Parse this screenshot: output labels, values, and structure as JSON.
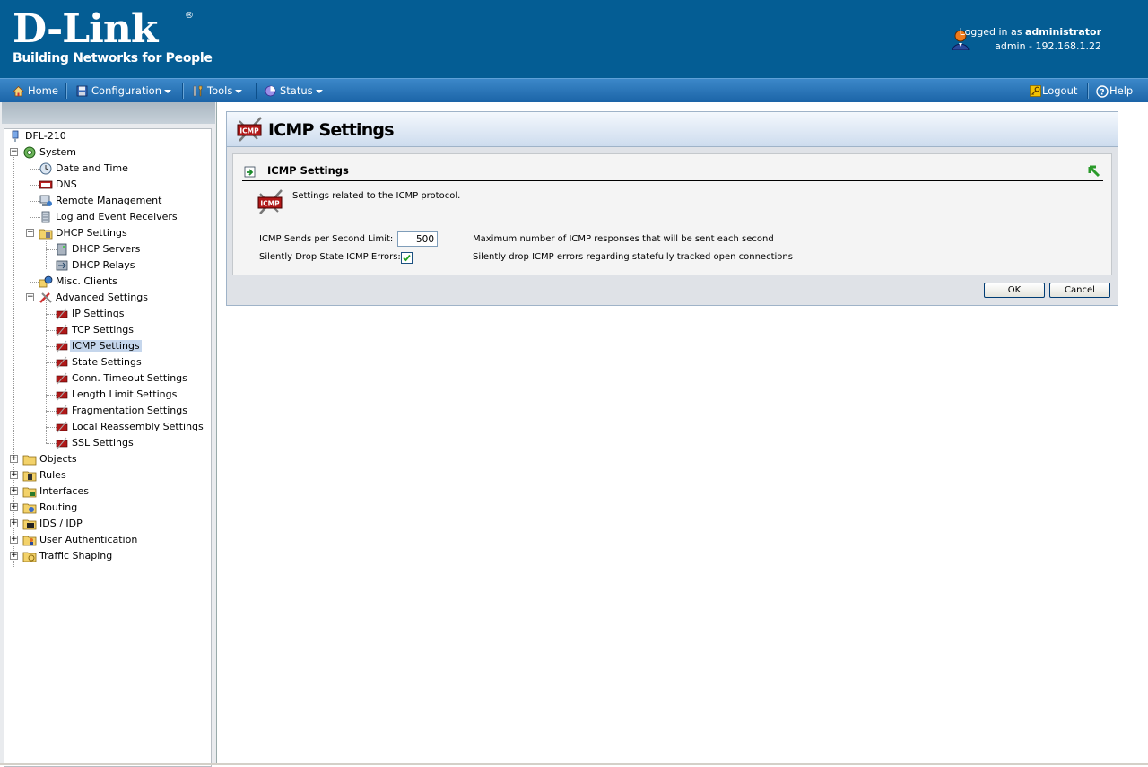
{
  "header": {
    "brand": "D-Link",
    "registered": "®",
    "tagline": "Building Networks for People",
    "logged_in_prefix": "Logged in as ",
    "user": "administrator",
    "session": "admin - 192.168.1.22"
  },
  "menu": {
    "home": "Home",
    "configuration": "Configuration",
    "tools": "Tools",
    "status": "Status",
    "logout": "Logout",
    "help": "Help"
  },
  "tree": {
    "root": "DFL-210",
    "system": "System",
    "date_time": "Date and Time",
    "dns": "DNS",
    "remote_mgmt": "Remote Management",
    "log_receivers": "Log and Event Receivers",
    "dhcp_settings": "DHCP Settings",
    "dhcp_servers": "DHCP Servers",
    "dhcp_relays": "DHCP Relays",
    "misc_clients": "Misc. Clients",
    "advanced": "Advanced Settings",
    "ip": "IP Settings",
    "tcp": "TCP Settings",
    "icmp": "ICMP Settings",
    "state": "State Settings",
    "conn_timeout": "Conn. Timeout Settings",
    "length_limit": "Length Limit Settings",
    "fragmentation": "Fragmentation Settings",
    "local_reassembly": "Local Reassembly Settings",
    "ssl": "SSL Settings",
    "objects": "Objects",
    "rules": "Rules",
    "interfaces": "Interfaces",
    "routing": "Routing",
    "ids_idp": "IDS / IDP",
    "user_auth": "User Authentication",
    "traffic_shaping": "Traffic Shaping"
  },
  "page": {
    "title": "ICMP Settings",
    "icon_text": "ICMP",
    "section_title": "ICMP Settings",
    "description": "Settings related to the ICMP protocol.",
    "fields": {
      "limit_label": "ICMP Sends per Second Limit:",
      "limit_value": "500",
      "limit_help": "Maximum number of ICMP responses that will be sent each second",
      "drop_label": "Silently Drop State ICMP Errors:",
      "drop_checked": true,
      "drop_help": "Silently drop ICMP errors regarding statefully tracked open connections"
    },
    "ok": "OK",
    "cancel": "Cancel"
  },
  "colors": {
    "header_bg": "#045d94",
    "menubar": "#1b64a7",
    "selected": "#c5d6ec"
  }
}
